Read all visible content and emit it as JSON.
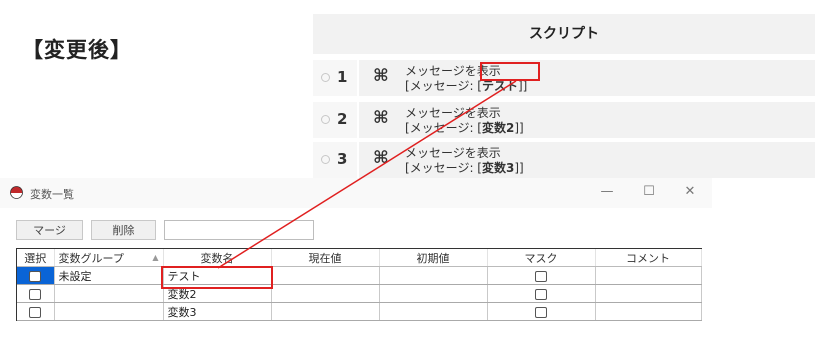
{
  "heading": "【変更後】",
  "script": {
    "header": "スクリプト",
    "rows": [
      {
        "num": "1",
        "icon": "⌘",
        "line1": "メッセージを表示",
        "prefix": "[メッセージ:  [",
        "value": "テスト",
        "suffix": "]]"
      },
      {
        "num": "2",
        "icon": "⌘",
        "line1": "メッセージを表示",
        "prefix": "[メッセージ:  [",
        "value": "変数2",
        "suffix": "]]"
      },
      {
        "num": "3",
        "icon": "⌘",
        "line1": "メッセージを表示",
        "prefix": "[メッセージ:  [",
        "value": "変数3",
        "suffix": "]]"
      }
    ]
  },
  "window": {
    "title": "変数一覧",
    "minimize": "—",
    "maximize": "☐",
    "close": "✕",
    "toolbar": {
      "merge": "マージ",
      "delete": "削除",
      "search_value": ""
    },
    "columns": [
      "選択",
      "変数グループ",
      "変数名",
      "現在値",
      "初期値",
      "マスク",
      "コメント"
    ],
    "rows": [
      {
        "group": "未設定",
        "name": "テスト",
        "current": "",
        "initial": "",
        "comment": ""
      },
      {
        "group": "",
        "name": "変数2",
        "current": "",
        "initial": "",
        "comment": ""
      },
      {
        "group": "",
        "name": "変数3",
        "current": "",
        "initial": "",
        "comment": ""
      }
    ]
  },
  "accent_colors": {
    "highlight": "#e02020",
    "selection": "#0a64d6"
  }
}
